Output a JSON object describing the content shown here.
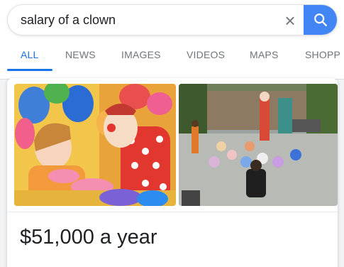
{
  "search": {
    "query": "salary of a clown",
    "clear_symbol": "×"
  },
  "tabs": [
    {
      "label": "ALL",
      "active": true
    },
    {
      "label": "NEWS",
      "active": false
    },
    {
      "label": "IMAGES",
      "active": false
    },
    {
      "label": "VIDEOS",
      "active": false
    },
    {
      "label": "MAPS",
      "active": false
    },
    {
      "label": "SHOPP",
      "active": false
    }
  ],
  "result": {
    "images": [
      {
        "subject": "clown with child and balloons"
      },
      {
        "subject": "clown performing for children in park"
      }
    ],
    "answer": "$51,000 a year"
  },
  "colors": {
    "accent": "#1a73e8",
    "search_button": "#4285f4",
    "tab_inactive": "#70757a"
  },
  "icons": {
    "clear": "close-icon",
    "search": "search-icon"
  }
}
